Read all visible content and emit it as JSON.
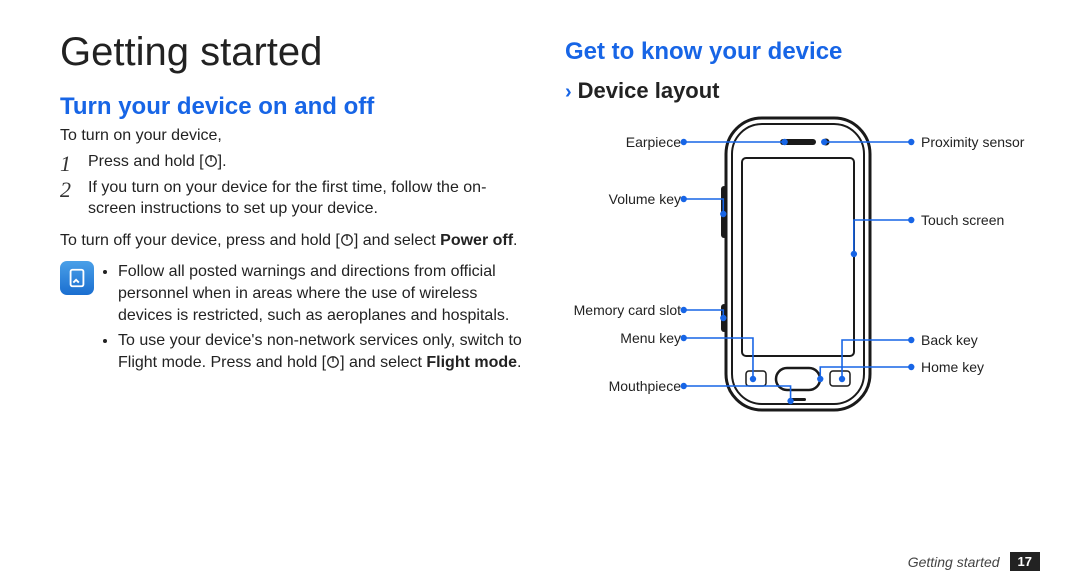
{
  "left": {
    "title": "Getting started",
    "section": "Turn your device on and off",
    "lead": "To turn on your device,",
    "steps": [
      "Press and hold [",
      "If you turn on your device for the first time, follow the on-screen instructions to set up your device."
    ],
    "step1_tail": "].",
    "off_pre": "To turn off your device, press and hold [",
    "off_post": "] and select ",
    "off_bold": "Power off",
    "off_end": ".",
    "notes": [
      "Follow all posted warnings and directions from official personnel when in areas where the use of wireless devices is restricted, such as aeroplanes and hospitals.",
      "To use your device's non-network services only, switch to Flight mode. Press and hold ["
    ],
    "note2_post": "] and select ",
    "note2_bold": "Flight mode",
    "note2_end": "."
  },
  "right": {
    "section": "Get to know your device",
    "subsection": "Device layout",
    "labels": {
      "earpiece": "Earpiece",
      "volume": "Volume key",
      "memslot": "Memory card slot",
      "menu": "Menu key",
      "mouth": "Mouthpiece",
      "prox": "Proximity sensor",
      "touch": "Touch screen",
      "back": "Back key",
      "home": "Home key"
    }
  },
  "footer": {
    "section": "Getting started",
    "page": "17"
  }
}
